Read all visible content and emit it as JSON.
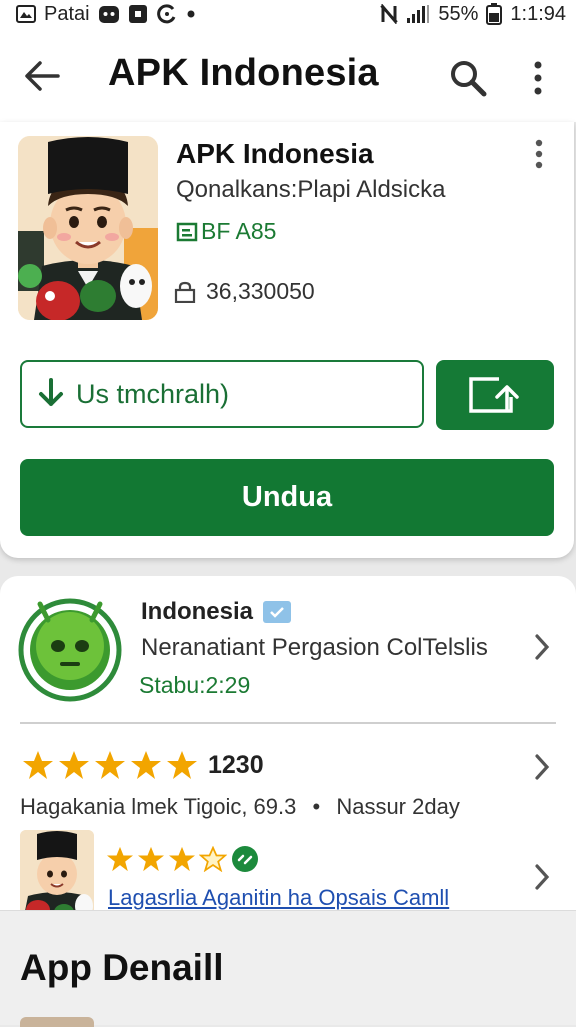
{
  "status_bar": {
    "carrier": "Patai",
    "battery": "55%",
    "time": "1:1:94",
    "icons": [
      "app-icon",
      "cat-icon",
      "square-app-icon",
      "refresh-icon",
      "dot-icon",
      "no-nfc-icon",
      "signal-icon",
      "battery-icon"
    ]
  },
  "app_bar": {
    "title": "APK Indonesia",
    "icons": [
      "back-arrow-icon",
      "search-icon",
      "more-vert-icon"
    ]
  },
  "app_card": {
    "title": "APK Indonesia",
    "subtitle": "Qonalkans:Plapi Aldsicka",
    "tag": "BF A85",
    "count": "36,330050",
    "outline_button": "Us tmchralh)",
    "primary_button": "Undua",
    "accent_color": "#127833",
    "icons": [
      "app-character-icon",
      "tag-icon",
      "lock-icon",
      "download-icon",
      "share-icon",
      "more-vert-icon"
    ]
  },
  "developer": {
    "name": "Indonesia",
    "description": "Neranatiant Pergasion ColTelslis",
    "status": "Stabu:2:29",
    "icons": [
      "android-logo-icon",
      "verified-icon",
      "chevron-right-icon"
    ]
  },
  "ratings": {
    "stars": 5,
    "count": "1230",
    "meta_left": "Hagakania lmek Tigoic, 69.3",
    "separator": "•",
    "meta_right": "Nassur 2day",
    "star_color": "#f2a500"
  },
  "review": {
    "stars_filled": 3,
    "stars_total": 4,
    "link": "Lagasrlia Aganitin ha Opsais Camll",
    "icons": [
      "avatar-icon",
      "green-badge-icon",
      "chevron-right-icon"
    ]
  },
  "bottom_sheet": {
    "title": "App Denaill"
  }
}
